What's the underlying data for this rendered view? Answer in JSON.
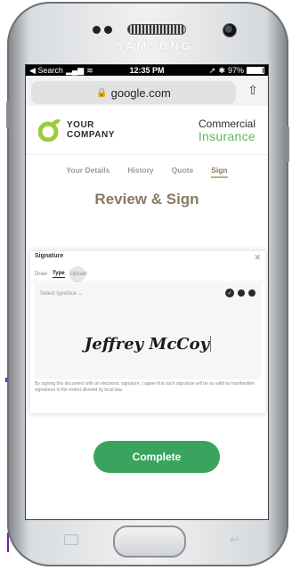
{
  "status_bar": {
    "carrier": "◀ Search",
    "time": "12:35 PM",
    "battery": "97%"
  },
  "browser": {
    "url": "google.com"
  },
  "phone": {
    "brand": "SAMSUNG"
  },
  "header": {
    "logo_line1": "YOUR",
    "logo_line2": "COMPANY",
    "brand_line1": "Commercial",
    "brand_line2": "Insurance"
  },
  "tabs": [
    {
      "label": "Your Details"
    },
    {
      "label": "History"
    },
    {
      "label": "Quote"
    },
    {
      "label": "Sign"
    }
  ],
  "page_title": "Review & Sign",
  "signature_modal": {
    "title": "Signature",
    "tabs": [
      {
        "label": "Draw"
      },
      {
        "label": "Type"
      },
      {
        "label": "Upload"
      }
    ],
    "select_typeface": "Select typeface",
    "signature_text": "Jeffrey McCoy",
    "legal_text": "By signing this document with an electronic signature, I agree that such signature will be as valid as handwritten signatures to the extent allowed by local law."
  },
  "complete_button": "Complete",
  "colors": {
    "accent_green": "#3aa45f",
    "title_tan": "#8a7a64",
    "logo_green": "#9ccb3b"
  }
}
